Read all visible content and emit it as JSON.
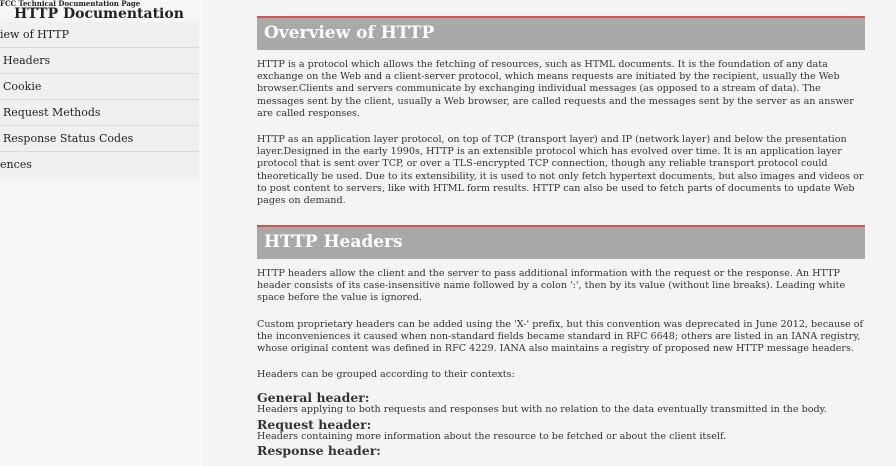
{
  "navbar": {
    "tiny_title": "FCC Technical Documentation Page",
    "title": "HTTP Documentation",
    "items": [
      {
        "label": "iew of HTTP"
      },
      {
        "label": "Headers"
      },
      {
        "label": "Cookie"
      },
      {
        "label": "Request Methods"
      },
      {
        "label": "Response Status Codes"
      },
      {
        "label": "ences"
      }
    ]
  },
  "overview": {
    "title": "Overview of HTTP",
    "p1": "HTTP is a protocol which allows the fetching of resources, such as HTML documents. It is the foundation of any data exchange on the Web and a client-server protocol, which means requests are initiated by the recipient, usually the Web browser.Clients and servers communicate by exchanging individual messages (as opposed to a stream of data). The messages sent by the client, usually a Web browser, are called requests and the messages sent by the server as an answer are called responses.",
    "p2": "HTTP as an application layer protocol, on top of TCP (transport layer) and IP (network layer) and below the presentation layer.Designed in the early 1990s, HTTP is an extensible protocol which has evolved over time. It is an application layer protocol that is sent over TCP, or over a TLS-encrypted TCP connection, though any reliable transport protocol could theoretically be used. Due to its extensibility, it is used to not only fetch hypertext documents, but also images and videos or to post content to servers, like with HTML form results. HTTP can also be used to fetch parts of documents to update Web pages on demand."
  },
  "headers": {
    "title": "HTTP Headers",
    "p1": "HTTP headers allow the client and the server to pass additional information with the request or the response. An HTTP header consists of its case-insensitive name followed by a colon ':', then by its value (without line breaks). Leading white space before the value is ignored.",
    "p2": "Custom proprietary headers can be added using the 'X-' prefix, but this convention was deprecated in June 2012, because of the inconveniences it caused when non-standard fields became standard in RFC 6648; others are listed in an IANA registry, whose original content was defined in RFC 4229. IANA also maintains a registry of proposed new HTTP message headers.",
    "p3": "Headers can be grouped according to their contexts:",
    "general_title": "General header:",
    "general_text": "Headers applying to both requests and responses but with no relation to the data eventually transmitted in the body.",
    "request_title": "Request header:",
    "request_text": "Headers containing more information about the resource to be fetched or about the client itself.",
    "response_title": "Response header:"
  },
  "colors": {
    "header_bg": "#a9a9a9",
    "header_accent": "#d9534f",
    "main_bg": "#f4f4f4",
    "nav_bg": "#f0f0f0"
  }
}
